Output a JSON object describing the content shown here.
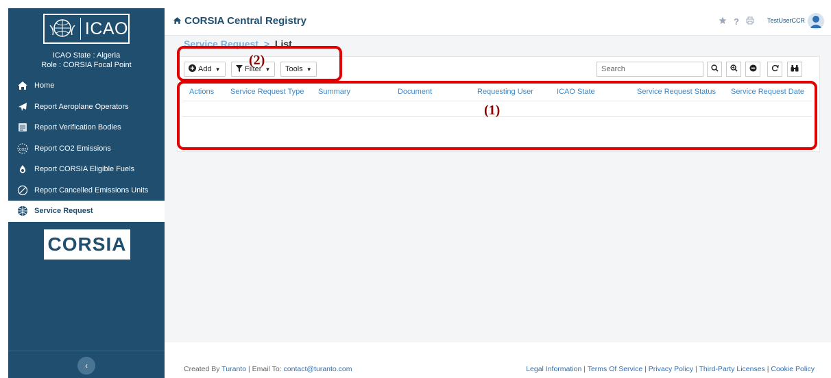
{
  "sidebar": {
    "logo_text": "ICAO",
    "state_line": "ICAO State : Algeria",
    "role_line": "Role : CORSIA Focal Point",
    "items": [
      {
        "label": "Home",
        "icon": "home-icon"
      },
      {
        "label": "Report Aeroplane Operators",
        "icon": "airplane-icon"
      },
      {
        "label": "Report Verification Bodies",
        "icon": "document-icon"
      },
      {
        "label": "Report CO2 Emissions",
        "icon": "co2-icon"
      },
      {
        "label": "Report CORSIA Eligible Fuels",
        "icon": "fuel-drop-icon"
      },
      {
        "label": "Report Cancelled Emissions Units",
        "icon": "cancelled-icon"
      },
      {
        "label": "Service Request",
        "icon": "globe-icon"
      }
    ],
    "corsia_logo": "CORSIA",
    "collapse_icon": "‹"
  },
  "header": {
    "title": "CORSIA Central Registry",
    "username": "TestUserCCR"
  },
  "breadcrumb": {
    "parent": "Service Request",
    "separator": ">",
    "current": "List"
  },
  "toolbar": {
    "add_label": "Add",
    "filter_label": "Filter",
    "tools_label": "Tools",
    "search_placeholder": "Search"
  },
  "table": {
    "columns": [
      "Actions",
      "Service Request Type",
      "Summary",
      "Document",
      "Requesting User",
      "ICAO State",
      "Service Request Status",
      "Service Request Date"
    ]
  },
  "annotations": {
    "label_1": "(1)",
    "label_2": "(2)"
  },
  "footer": {
    "created_by_prefix": "Created By",
    "company": "Turanto",
    "email_prefix": "| Email To:",
    "email": "contact@turanto.com",
    "links": [
      "Legal Information",
      "Terms Of Service",
      "Privacy Policy",
      "Third-Party Licenses",
      "Cookie Policy"
    ]
  },
  "colors": {
    "sidebar_bg": "#1f4e6e",
    "accent_blue": "#3a87c8",
    "annotation_red": "#e00000"
  }
}
